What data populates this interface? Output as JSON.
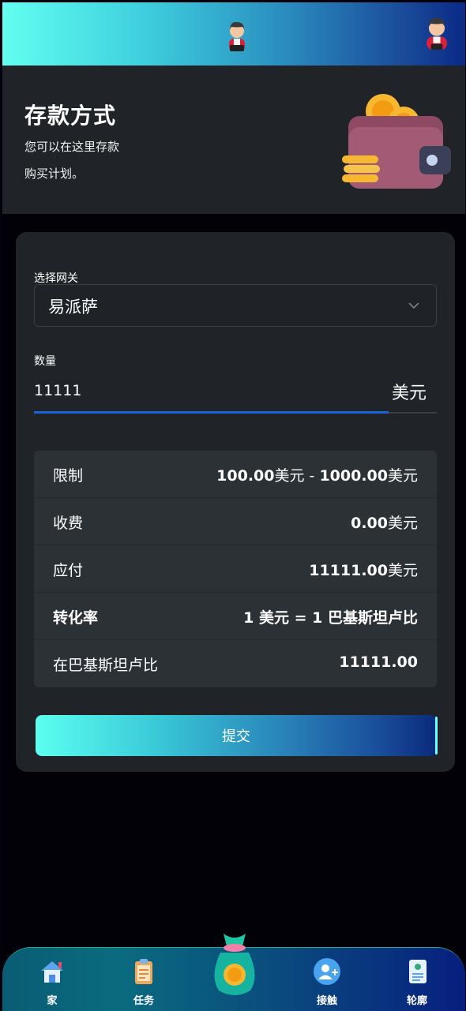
{
  "header": {
    "avatar_center": "user-avatar-icon",
    "avatar_right": "user-avatar-icon"
  },
  "hero": {
    "title": "存款方式",
    "line1": "您可以在这里存款",
    "line2": "购买计划。",
    "illustration": "wallet-coins-icon"
  },
  "form": {
    "gateway_label": "选择网关",
    "gateway_value": "易派萨",
    "amount_label": "数量",
    "amount_value": "11111",
    "amount_unit": "美元",
    "amount_progress_percent": 88
  },
  "summary": {
    "limit": {
      "label": "限制",
      "min": "100.00",
      "max": "1000.00",
      "unit": "美元",
      "sep": " - "
    },
    "fee": {
      "label": "收费",
      "value": "0.00",
      "unit": "美元"
    },
    "payable": {
      "label": "应付",
      "value": "11111.00",
      "unit": "美元"
    },
    "rate": {
      "label": "转化率",
      "value": "1 美元 = 1 巴基斯坦卢比"
    },
    "in_pkr": {
      "label": "在巴基斯坦卢比",
      "value": "11111.00"
    }
  },
  "submit_label": "提交",
  "nav": {
    "home": "家",
    "tasks": "任务",
    "contact": "接触",
    "profile": "轮廓"
  },
  "colors": {
    "accent_gradient_start": "#62fff0",
    "accent_gradient_end": "#0b2a86",
    "card": "#202428",
    "underline": "#1b64d8"
  }
}
